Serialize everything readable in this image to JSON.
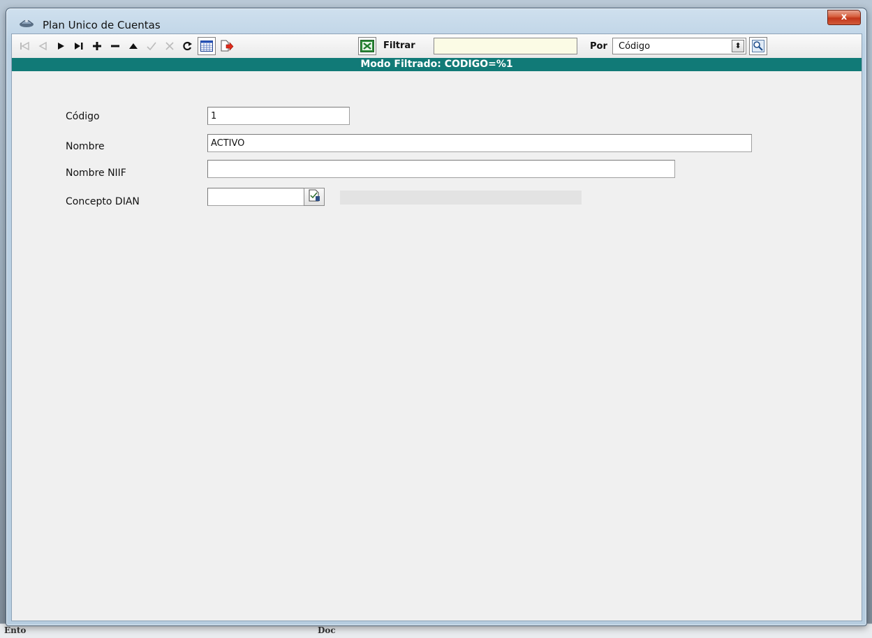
{
  "window": {
    "title": "Plan Unico de Cuentas",
    "close_label": "x"
  },
  "toolbar": {
    "buttons": [
      {
        "name": "first-record-icon",
        "enabled": false
      },
      {
        "name": "previous-record-icon",
        "enabled": false
      },
      {
        "name": "next-record-icon",
        "enabled": true
      },
      {
        "name": "last-record-icon",
        "enabled": true
      },
      {
        "name": "insert-record-icon",
        "enabled": true
      },
      {
        "name": "delete-record-icon",
        "enabled": true
      },
      {
        "name": "edit-record-icon",
        "enabled": true
      },
      {
        "name": "post-edit-icon",
        "enabled": false
      },
      {
        "name": "cancel-edit-icon",
        "enabled": false
      },
      {
        "name": "refresh-icon",
        "enabled": true
      },
      {
        "name": "grid-view-icon",
        "enabled": true
      },
      {
        "name": "export-icon",
        "enabled": true
      },
      {
        "name": "excel-icon",
        "enabled": true
      }
    ],
    "filter_label": "Filtrar",
    "filter_value": "",
    "by_label": "Por",
    "by_selected": "Código"
  },
  "mode_banner": "Modo Filtrado: CODIGO=%1",
  "form": {
    "codigo_label": "Código",
    "codigo_value": "1",
    "nombre_label": "Nombre",
    "nombre_value": "ACTIVO",
    "nombre_niif_label": "Nombre NIIF",
    "nombre_niif_value": "",
    "concepto_dian_label": "Concepto DIAN",
    "concepto_dian_value": "",
    "concepto_dian_description": ""
  },
  "background_fragments": [
    "Ento",
    "Doc"
  ],
  "colors": {
    "mode_banner_bg": "#117a77",
    "filter_input_bg": "#fbfbe5",
    "close_button": "#c2361a"
  }
}
